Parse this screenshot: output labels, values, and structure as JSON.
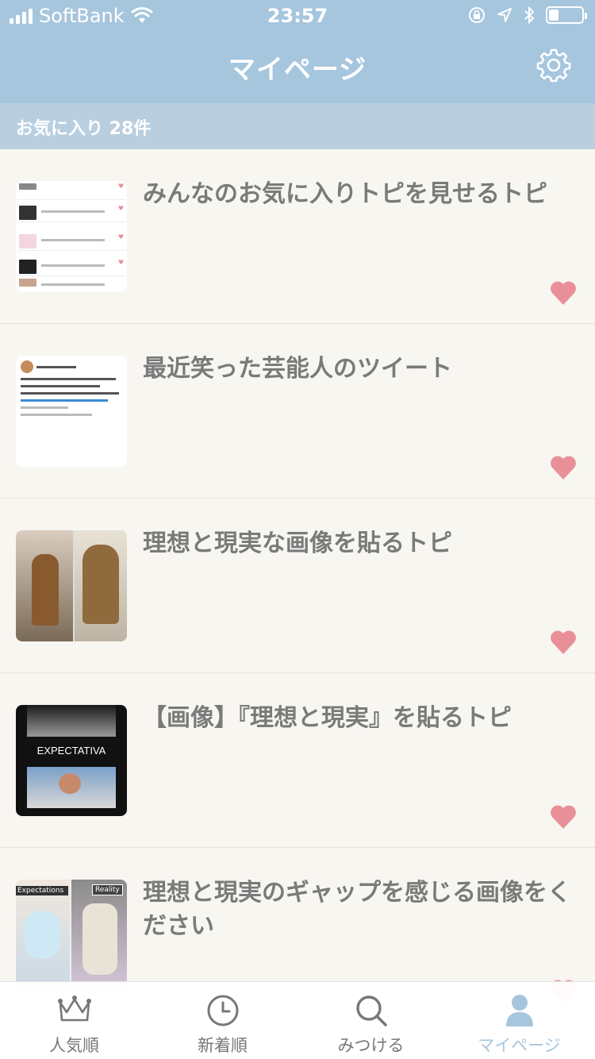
{
  "status_bar": {
    "carrier": "SoftBank",
    "time": "23:57"
  },
  "header": {
    "title": "マイページ",
    "settings_icon": "gear-icon"
  },
  "favorites_header": {
    "label": "お気に入り 28件"
  },
  "items": [
    {
      "title": "みんなのお気に入りトピを見せるトピ",
      "favorited": true
    },
    {
      "title": "最近笑った芸能人のツイート",
      "favorited": true
    },
    {
      "title": "理想と現実な画像を貼るトピ",
      "favorited": true
    },
    {
      "title": "【画像】『理想と現実』を貼るトピ",
      "favorited": true,
      "thumb_text": "EXPECTATIVA"
    },
    {
      "title": "理想と現実のギャップを感じる画像をください",
      "favorited": true,
      "thumb_labels": [
        "Expectations",
        "Reality"
      ]
    }
  ],
  "tabbar": {
    "tabs": [
      {
        "label": "人気順",
        "icon": "crown-icon"
      },
      {
        "label": "新着順",
        "icon": "clock-icon"
      },
      {
        "label": "みつける",
        "icon": "search-icon"
      },
      {
        "label": "マイページ",
        "icon": "person-icon"
      }
    ],
    "active": "マイページ"
  },
  "colors": {
    "header": "#a6c6de",
    "subheader": "#b9cfdf",
    "heart": "#e98f98",
    "title_text": "#7a7a7a",
    "background": "#f8f6f1"
  },
  "battery_level": 0.3
}
